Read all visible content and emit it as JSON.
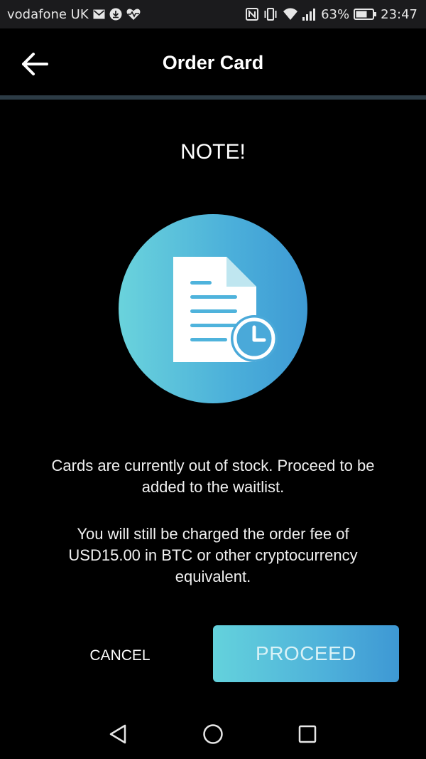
{
  "status_bar": {
    "carrier": "vodafone UK",
    "battery": "63%",
    "time": "23:47",
    "icons_left": [
      "mail-icon",
      "download-icon",
      "heart-rate-icon"
    ],
    "icons_right": [
      "nfc-icon",
      "vibrate-icon",
      "wifi-icon",
      "signal-icon",
      "battery-icon"
    ]
  },
  "header": {
    "title": "Order Card",
    "back_icon": "arrow-left-icon"
  },
  "content": {
    "note_title": "NOTE!",
    "illustration_icon": "document-clock-icon",
    "message_1": "Cards are currently out of stock. Proceed to be added to the waitlist.",
    "message_2": "You will still be charged the order fee of USD15.00 in BTC or other cryptocurrency equivalent."
  },
  "actions": {
    "cancel_label": "CANCEL",
    "proceed_label": "PROCEED"
  },
  "nav_bar": {
    "icons": [
      "nav-back-icon",
      "nav-home-icon",
      "nav-recents-icon"
    ]
  },
  "colors": {
    "background": "#000000",
    "status_bar": "#1b1b1d",
    "divider": "#2c3b45",
    "accent_start": "#64d2dc",
    "accent_end": "#3e98d4"
  }
}
